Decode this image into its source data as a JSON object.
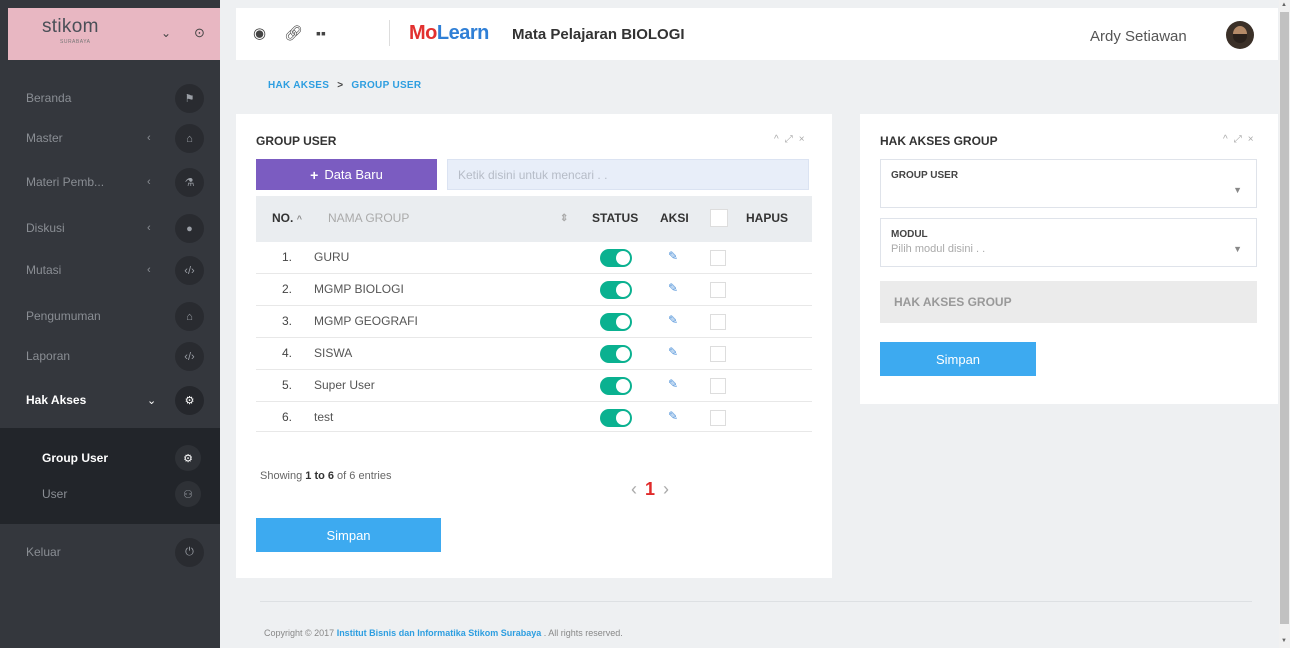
{
  "brand": {
    "logo": "stikom",
    "tagline": "SURABAYA"
  },
  "sidebar": {
    "items": [
      {
        "label": "Beranda",
        "arrow": "",
        "icon": "flag-icon"
      },
      {
        "label": "Master",
        "arrow": "‹",
        "icon": "home-icon"
      },
      {
        "label": "Materi Pemb...",
        "arrow": "‹",
        "icon": "flask-icon"
      },
      {
        "label": "Diskusi",
        "arrow": "‹",
        "icon": "comments-icon"
      },
      {
        "label": "Mutasi",
        "arrow": "‹",
        "icon": "code-icon"
      },
      {
        "label": "Pengumuman",
        "arrow": "",
        "icon": "home-icon"
      },
      {
        "label": "Laporan",
        "arrow": "",
        "icon": "code-icon"
      },
      {
        "label": "Hak Akses",
        "arrow": "⌄",
        "icon": "cogs-icon"
      }
    ],
    "subitems": [
      {
        "label": "Group User",
        "icon": "gear-icon"
      },
      {
        "label": "User",
        "icon": "users-icon"
      }
    ],
    "logout": {
      "label": "Keluar",
      "icon": "power-icon"
    }
  },
  "topbar": {
    "brand_mo": "Mo",
    "brand_learn": "Learn",
    "subtitle": "Mata Pelajaran BIOLOGI",
    "username": "Ardy Setiawan"
  },
  "breadcrumb": {
    "parent": "HAK AKSES",
    "current": "GROUP USER"
  },
  "group_panel": {
    "title": "GROUP USER",
    "new_button": "Data Baru",
    "search_placeholder": "Ketik disini untuk mencari . .",
    "columns": {
      "no": "NO.",
      "name": "NAMA GROUP",
      "status": "STATUS",
      "action": "AKSI",
      "delete": "HAPUS"
    },
    "rows": [
      {
        "no": "1.",
        "name": "GURU",
        "status": true
      },
      {
        "no": "2.",
        "name": "MGMP BIOLOGI",
        "status": true
      },
      {
        "no": "3.",
        "name": "MGMP GEOGRAFI",
        "status": true
      },
      {
        "no": "4.",
        "name": "SISWA",
        "status": true
      },
      {
        "no": "5.",
        "name": "Super User",
        "status": true
      },
      {
        "no": "6.",
        "name": "test",
        "status": true
      }
    ],
    "showing_prefix": "Showing ",
    "showing_range": "1 to 6",
    "showing_suffix": " of 6 entries",
    "current_page": "1",
    "save_button": "Simpan"
  },
  "access_panel": {
    "title": "HAK AKSES GROUP",
    "group_label": "GROUP USER",
    "group_value": "",
    "module_label": "MODUL",
    "module_placeholder": "Pilih modul disini . .",
    "access_box": "HAK AKSES GROUP",
    "save_button": "Simpan"
  },
  "footer": {
    "prefix": "Copyright © 2017 ",
    "link": "Institut Bisnis dan Informatika Stikom Surabaya",
    "suffix": " . All rights reserved."
  },
  "colors": {
    "sidebar": "#34373d",
    "brand": "#e8b7c2",
    "accent": "#7b5cc1",
    "primary": "#3daaf0",
    "toggle": "#0ab190"
  }
}
